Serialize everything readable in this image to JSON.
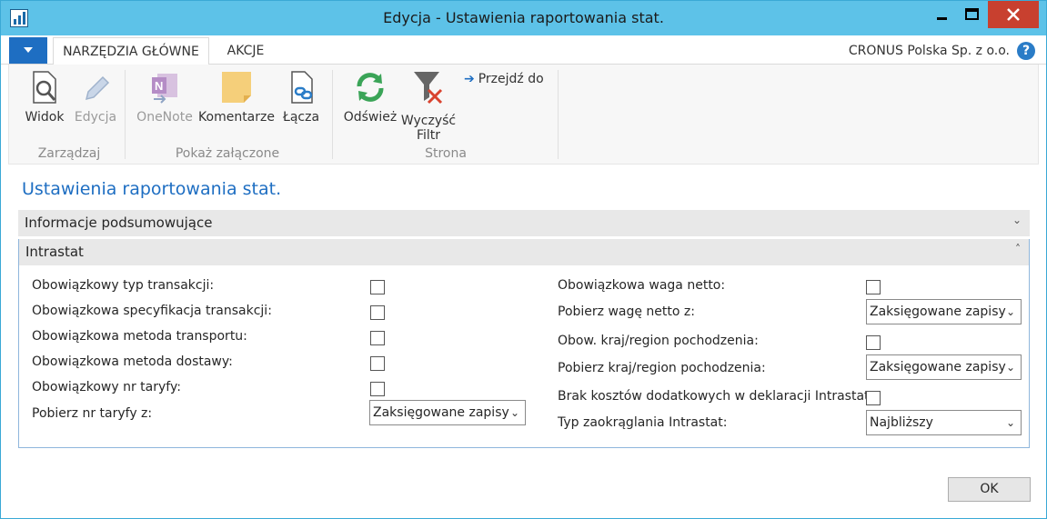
{
  "window": {
    "title": "Edycja - Ustawienia raportowania stat.",
    "close_color": "#c8402f",
    "titlebar_color": "#5dc2e8"
  },
  "ribbon": {
    "tabs": [
      {
        "label": "NARZĘDZIA GŁÓWNE",
        "active": true
      },
      {
        "label": "AKCJE",
        "active": false
      }
    ],
    "company": "CRONUS Polska Sp. z o.o.",
    "help_label": "?",
    "groups": [
      {
        "label": "Zarządzaj",
        "buttons": [
          {
            "label": "Widok",
            "icon": "view-icon",
            "enabled": true
          },
          {
            "label": "Edycja",
            "icon": "edit-pencil-icon",
            "enabled": false
          }
        ]
      },
      {
        "label": "Pokaż załączone",
        "buttons": [
          {
            "label": "OneNote",
            "icon": "onenote-icon",
            "enabled": false
          },
          {
            "label": "Komentarze",
            "icon": "comments-note-icon",
            "enabled": true
          },
          {
            "label": "Łącza",
            "icon": "links-icon",
            "enabled": true
          }
        ]
      },
      {
        "label": "Strona",
        "buttons": [
          {
            "label": "Odśwież",
            "icon": "refresh-icon",
            "enabled": true
          },
          {
            "label": "Wyczyść Filtr",
            "line1": "Wyczyść",
            "line2": "Filtr",
            "icon": "clear-filter-icon",
            "enabled": true
          },
          {
            "label": "Przejdź do",
            "icon": "arrow-right-icon",
            "enabled": true
          }
        ]
      }
    ]
  },
  "page": {
    "title": "Ustawienia raportowania stat.",
    "fasttabs": [
      {
        "label": "Informacje podsumowujące",
        "expanded": false
      },
      {
        "label": "Intrastat",
        "expanded": true
      }
    ]
  },
  "intrastat": {
    "left": [
      {
        "label": "Obowiązkowy typ transakcji:",
        "type": "checkbox",
        "checked": false
      },
      {
        "label": "Obowiązkowa specyfikacja transakcji:",
        "type": "checkbox",
        "checked": false
      },
      {
        "label": "Obowiązkowa metoda transportu:",
        "type": "checkbox",
        "checked": false
      },
      {
        "label": "Obowiązkowa metoda dostawy:",
        "type": "checkbox",
        "checked": false
      },
      {
        "label": "Obowiązkowy nr taryfy:",
        "type": "checkbox",
        "checked": false
      },
      {
        "label": "Pobierz nr taryfy z:",
        "type": "select",
        "value": "Zaksięgowane zapisy"
      }
    ],
    "right": [
      {
        "label": "Obowiązkowa waga netto:",
        "type": "checkbox",
        "checked": false
      },
      {
        "label": "Pobierz wagę netto z:",
        "type": "select",
        "value": "Zaksięgowane zapisy"
      },
      {
        "label": "Obow. kraj/region pochodzenia:",
        "type": "checkbox",
        "checked": false
      },
      {
        "label": "Pobierz kraj/region pochodzenia:",
        "type": "select",
        "value": "Zaksięgowane zapisy"
      },
      {
        "label": "Brak kosztów dodatkowych w deklaracji Intrastat:",
        "type": "checkbox",
        "checked": false
      },
      {
        "label": "Typ zaokrąglania Intrastat:",
        "type": "select",
        "value": "Najbliższy"
      }
    ]
  },
  "footer": {
    "ok_label": "OK"
  }
}
